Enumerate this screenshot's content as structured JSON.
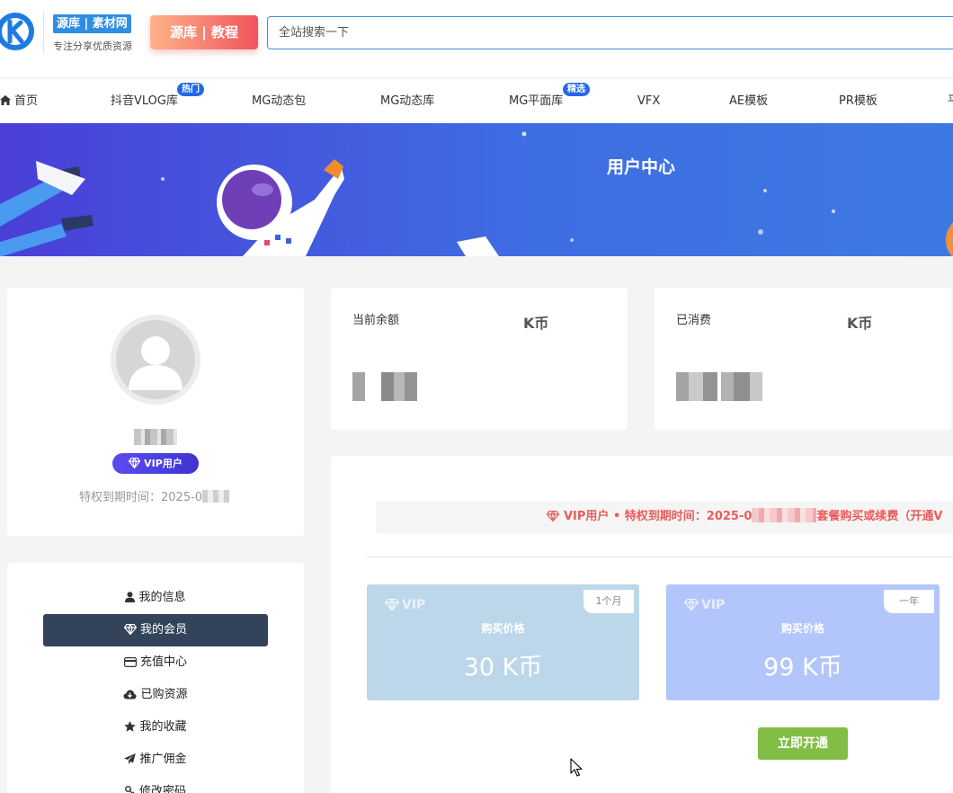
{
  "header": {
    "brand_name": "源库 | 素材网",
    "brand_slogan": "专注分享优质资源",
    "tutorial_button": "源库 | 教程",
    "search_placeholder": "全站搜索一下"
  },
  "nav": {
    "items": [
      {
        "label": "首页"
      },
      {
        "label": "抖音VLOG库",
        "badge": "热门"
      },
      {
        "label": "MG动态包"
      },
      {
        "label": "MG动态库"
      },
      {
        "label": "MG平面库",
        "badge": "精选"
      },
      {
        "label": "VFX"
      },
      {
        "label": "AE模板"
      },
      {
        "label": "PR模板"
      },
      {
        "label": "平"
      }
    ]
  },
  "banner": {
    "title": "用户中心"
  },
  "profile": {
    "vip_badge": "VIP用户",
    "expiry_label": "特权到期时间：2025-0"
  },
  "menu": {
    "items": [
      {
        "label": "我的信息",
        "icon": "user-icon"
      },
      {
        "label": "我的会员",
        "icon": "diamond-icon",
        "active": true
      },
      {
        "label": "充值中心",
        "icon": "credit-card-icon"
      },
      {
        "label": "已购资源",
        "icon": "cloud-download-icon"
      },
      {
        "label": "我的收藏",
        "icon": "star-icon"
      },
      {
        "label": "推广佣金",
        "icon": "paper-plane-icon"
      },
      {
        "label": "修改密码",
        "icon": "key-icon"
      }
    ]
  },
  "stats": {
    "balance": {
      "label": "当前余额",
      "unit": "K币"
    },
    "spent": {
      "label": "已消费",
      "unit": "K币"
    }
  },
  "vip": {
    "notice_prefix": "VIP用户 • 特权到期时间：2025-0",
    "notice_suffix": "套餐购买或续费（开通V",
    "plans": [
      {
        "vip": "VIP",
        "period": "1个月",
        "label": "购买价格",
        "price": "30 K币"
      },
      {
        "vip": "VIP",
        "period": "一年",
        "label": "购买价格",
        "price": "99 K币"
      }
    ],
    "open_button": "立即开通"
  },
  "colors": {
    "accent": "#2f8de4",
    "active_menu": "#33445a",
    "notice_red": "#ec5b5b",
    "open_green": "#82bd45"
  }
}
